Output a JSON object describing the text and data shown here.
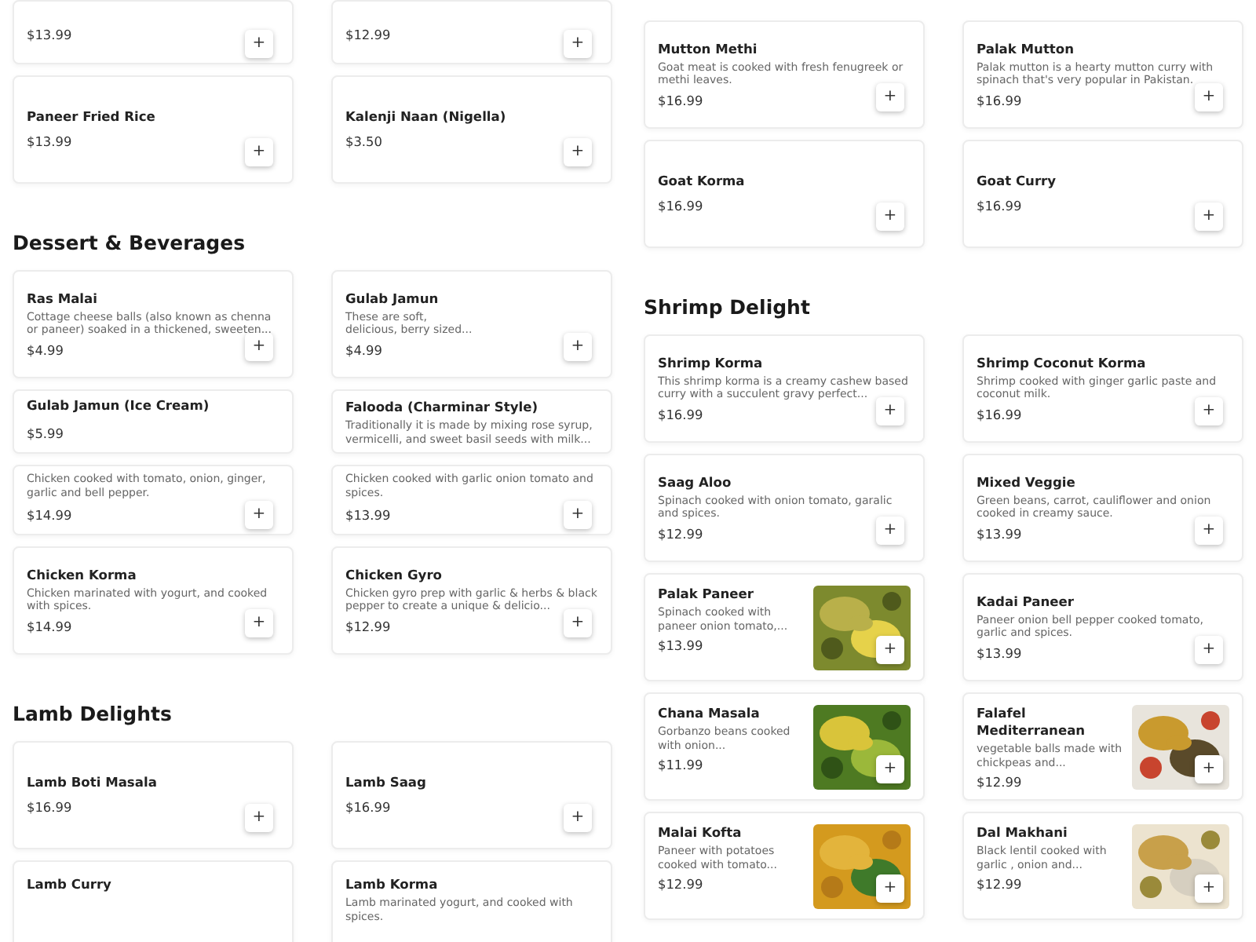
{
  "columns": [
    {
      "sections": [
        {
          "items": [
            {
              "kind": "compact",
              "price": "$13.99",
              "add": "+"
            },
            {
              "kind": "compact",
              "price": "$12.99",
              "add": "+"
            },
            {
              "kind": "plain",
              "name": "Paneer Fried Rice",
              "price": "$13.99",
              "add": "+"
            },
            {
              "kind": "plain",
              "name": "Kalenji Naan (Nigella)",
              "price": "$3.50",
              "add": "+"
            }
          ]
        },
        {
          "heading": "Dessert & Beverages",
          "items": [
            {
              "kind": "plain",
              "name": "Ras Malai",
              "description": "Cottage cheese balls (also known as chenna or paneer) soaked in a thickened, sweeten...",
              "price": "$4.99",
              "add": "+"
            },
            {
              "kind": "plain",
              "name": "Gulab Jamun",
              "description": "These are soft,\ndelicious, berry sized...",
              "price": "$4.99",
              "add": "+"
            },
            {
              "kind": "compact",
              "name": "Gulab Jamun (Ice Cream)",
              "price": "$5.99"
            },
            {
              "kind": "compact",
              "name": "Falooda (Charminar Style)",
              "description": "Traditionally it is made by mixing rose syrup, vermicelli, and sweet basil seeds with milk..."
            },
            {
              "kind": "compact",
              "description": "Chicken cooked with tomato, onion, ginger, garlic and bell pepper.",
              "price": "$14.99",
              "add": "+"
            },
            {
              "kind": "compact",
              "description": "Chicken cooked with garlic onion tomato and spices.",
              "price": "$13.99",
              "add": "+"
            },
            {
              "kind": "plain",
              "name": "Chicken Korma",
              "description": "Chicken marinated with yogurt, and cooked with spices.",
              "price": "$14.99",
              "add": "+"
            },
            {
              "kind": "plain",
              "name": "Chicken Gyro",
              "description": "Chicken gyro prep with garlic & herbs & black pepper to create a unique & delicio...",
              "price": "$12.99",
              "add": "+"
            }
          ]
        },
        {
          "heading": "Lamb Delights",
          "items": [
            {
              "kind": "plain",
              "name": "Lamb Boti Masala",
              "price": "$16.99",
              "add": "+"
            },
            {
              "kind": "plain",
              "name": "Lamb Saag",
              "price": "$16.99",
              "add": "+"
            },
            {
              "kind": "cut",
              "name": "Lamb Curry"
            },
            {
              "kind": "cut",
              "name": "Lamb Korma",
              "description": "Lamb marinated yogurt, and cooked with spices."
            }
          ]
        }
      ]
    },
    {
      "sections": [
        {
          "items": [
            {
              "kind": "plain",
              "name": "Mutton Methi",
              "description": "Goat meat is cooked with fresh fenugreek or methi leaves.",
              "price": "$16.99",
              "add": "+"
            },
            {
              "kind": "plain",
              "name": "Palak Mutton",
              "description": "Palak mutton is a hearty mutton curry with spinach that's very popular in Pakistan.",
              "price": "$16.99",
              "add": "+"
            },
            {
              "kind": "plain",
              "name": "Goat Korma",
              "price": "$16.99",
              "add": "+"
            },
            {
              "kind": "plain",
              "name": "Goat Curry",
              "price": "$16.99",
              "add": "+"
            }
          ]
        },
        {
          "heading": "Shrimp Delight",
          "items": [
            {
              "kind": "plain",
              "name": "Shrimp Korma",
              "description": "This shrimp korma is a creamy cashew based curry with a succulent gravy perfect...",
              "price": "$16.99",
              "add": "+"
            },
            {
              "kind": "plain",
              "name": "Shrimp Coconut Korma",
              "description": "Shrimp cooked with ginger garlic paste and coconut milk.",
              "price": "$16.99",
              "add": "+"
            },
            {
              "kind": "plain",
              "name": "Saag Aloo",
              "description": "Spinach cooked with onion tomato, garalic and spices.",
              "price": "$12.99",
              "add": "+"
            },
            {
              "kind": "plain",
              "name": "Mixed Veggie",
              "description": "Green beans, carrot, cauliflower and onion cooked in creamy sauce.",
              "price": "$13.99",
              "add": "+"
            },
            {
              "name": "Palak Paneer",
              "description": "Spinach cooked with paneer onion tomato,...",
              "price": "$13.99",
              "add": "+"
            },
            {
              "kind": "plain",
              "name": "Kadai Paneer",
              "description": "Paneer onion bell pepper cooked tomato, garlic and spices.",
              "price": "$13.99",
              "add": "+"
            },
            {
              "name": "Chana Masala",
              "description": "Gorbanzo beans cooked with onion...",
              "price": "$11.99",
              "add": "+"
            },
            {
              "name": "Falafel Mediterranean",
              "description": "vegetable balls made with chickpeas and...",
              "price": "$12.99",
              "add": "+"
            },
            {
              "name": "Malai Kofta",
              "description": "Paneer with potatoes cooked with tomato...",
              "price": "$12.99",
              "add": "+"
            },
            {
              "name": "Dal Makhani",
              "description": "Black lentil cooked with garlic , onion and...",
              "price": "$12.99",
              "add": "+"
            }
          ]
        }
      ]
    }
  ]
}
